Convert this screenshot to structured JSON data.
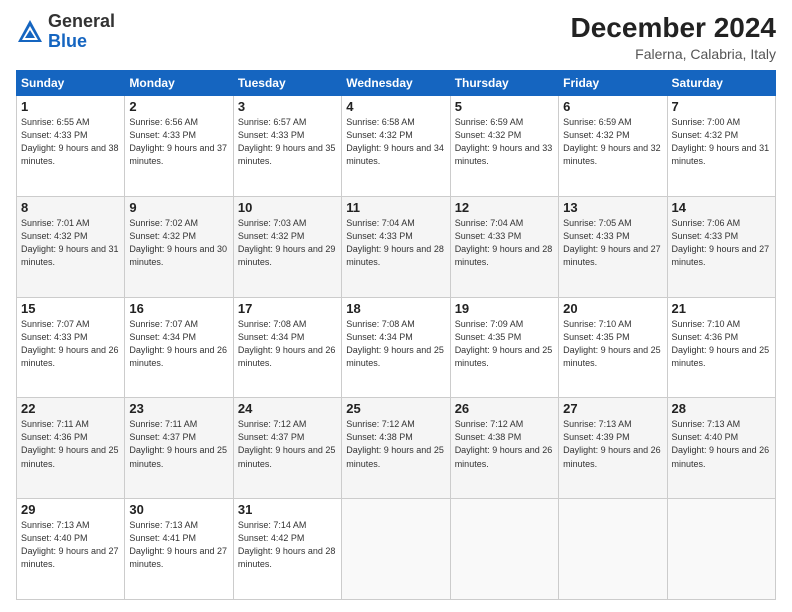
{
  "header": {
    "logo_general": "General",
    "logo_blue": "Blue",
    "month_title": "December 2024",
    "location": "Falerna, Calabria, Italy"
  },
  "weekdays": [
    "Sunday",
    "Monday",
    "Tuesday",
    "Wednesday",
    "Thursday",
    "Friday",
    "Saturday"
  ],
  "weeks": [
    [
      {
        "day": "1",
        "sunrise": "6:55 AM",
        "sunset": "4:33 PM",
        "daylight": "9 hours and 38 minutes."
      },
      {
        "day": "2",
        "sunrise": "6:56 AM",
        "sunset": "4:33 PM",
        "daylight": "9 hours and 37 minutes."
      },
      {
        "day": "3",
        "sunrise": "6:57 AM",
        "sunset": "4:33 PM",
        "daylight": "9 hours and 35 minutes."
      },
      {
        "day": "4",
        "sunrise": "6:58 AM",
        "sunset": "4:32 PM",
        "daylight": "9 hours and 34 minutes."
      },
      {
        "day": "5",
        "sunrise": "6:59 AM",
        "sunset": "4:32 PM",
        "daylight": "9 hours and 33 minutes."
      },
      {
        "day": "6",
        "sunrise": "6:59 AM",
        "sunset": "4:32 PM",
        "daylight": "9 hours and 32 minutes."
      },
      {
        "day": "7",
        "sunrise": "7:00 AM",
        "sunset": "4:32 PM",
        "daylight": "9 hours and 31 minutes."
      }
    ],
    [
      {
        "day": "8",
        "sunrise": "7:01 AM",
        "sunset": "4:32 PM",
        "daylight": "9 hours and 31 minutes."
      },
      {
        "day": "9",
        "sunrise": "7:02 AM",
        "sunset": "4:32 PM",
        "daylight": "9 hours and 30 minutes."
      },
      {
        "day": "10",
        "sunrise": "7:03 AM",
        "sunset": "4:32 PM",
        "daylight": "9 hours and 29 minutes."
      },
      {
        "day": "11",
        "sunrise": "7:04 AM",
        "sunset": "4:33 PM",
        "daylight": "9 hours and 28 minutes."
      },
      {
        "day": "12",
        "sunrise": "7:04 AM",
        "sunset": "4:33 PM",
        "daylight": "9 hours and 28 minutes."
      },
      {
        "day": "13",
        "sunrise": "7:05 AM",
        "sunset": "4:33 PM",
        "daylight": "9 hours and 27 minutes."
      },
      {
        "day": "14",
        "sunrise": "7:06 AM",
        "sunset": "4:33 PM",
        "daylight": "9 hours and 27 minutes."
      }
    ],
    [
      {
        "day": "15",
        "sunrise": "7:07 AM",
        "sunset": "4:33 PM",
        "daylight": "9 hours and 26 minutes."
      },
      {
        "day": "16",
        "sunrise": "7:07 AM",
        "sunset": "4:34 PM",
        "daylight": "9 hours and 26 minutes."
      },
      {
        "day": "17",
        "sunrise": "7:08 AM",
        "sunset": "4:34 PM",
        "daylight": "9 hours and 26 minutes."
      },
      {
        "day": "18",
        "sunrise": "7:08 AM",
        "sunset": "4:34 PM",
        "daylight": "9 hours and 25 minutes."
      },
      {
        "day": "19",
        "sunrise": "7:09 AM",
        "sunset": "4:35 PM",
        "daylight": "9 hours and 25 minutes."
      },
      {
        "day": "20",
        "sunrise": "7:10 AM",
        "sunset": "4:35 PM",
        "daylight": "9 hours and 25 minutes."
      },
      {
        "day": "21",
        "sunrise": "7:10 AM",
        "sunset": "4:36 PM",
        "daylight": "9 hours and 25 minutes."
      }
    ],
    [
      {
        "day": "22",
        "sunrise": "7:11 AM",
        "sunset": "4:36 PM",
        "daylight": "9 hours and 25 minutes."
      },
      {
        "day": "23",
        "sunrise": "7:11 AM",
        "sunset": "4:37 PM",
        "daylight": "9 hours and 25 minutes."
      },
      {
        "day": "24",
        "sunrise": "7:12 AM",
        "sunset": "4:37 PM",
        "daylight": "9 hours and 25 minutes."
      },
      {
        "day": "25",
        "sunrise": "7:12 AM",
        "sunset": "4:38 PM",
        "daylight": "9 hours and 25 minutes."
      },
      {
        "day": "26",
        "sunrise": "7:12 AM",
        "sunset": "4:38 PM",
        "daylight": "9 hours and 26 minutes."
      },
      {
        "day": "27",
        "sunrise": "7:13 AM",
        "sunset": "4:39 PM",
        "daylight": "9 hours and 26 minutes."
      },
      {
        "day": "28",
        "sunrise": "7:13 AM",
        "sunset": "4:40 PM",
        "daylight": "9 hours and 26 minutes."
      }
    ],
    [
      {
        "day": "29",
        "sunrise": "7:13 AM",
        "sunset": "4:40 PM",
        "daylight": "9 hours and 27 minutes."
      },
      {
        "day": "30",
        "sunrise": "7:13 AM",
        "sunset": "4:41 PM",
        "daylight": "9 hours and 27 minutes."
      },
      {
        "day": "31",
        "sunrise": "7:14 AM",
        "sunset": "4:42 PM",
        "daylight": "9 hours and 28 minutes."
      },
      null,
      null,
      null,
      null
    ]
  ]
}
